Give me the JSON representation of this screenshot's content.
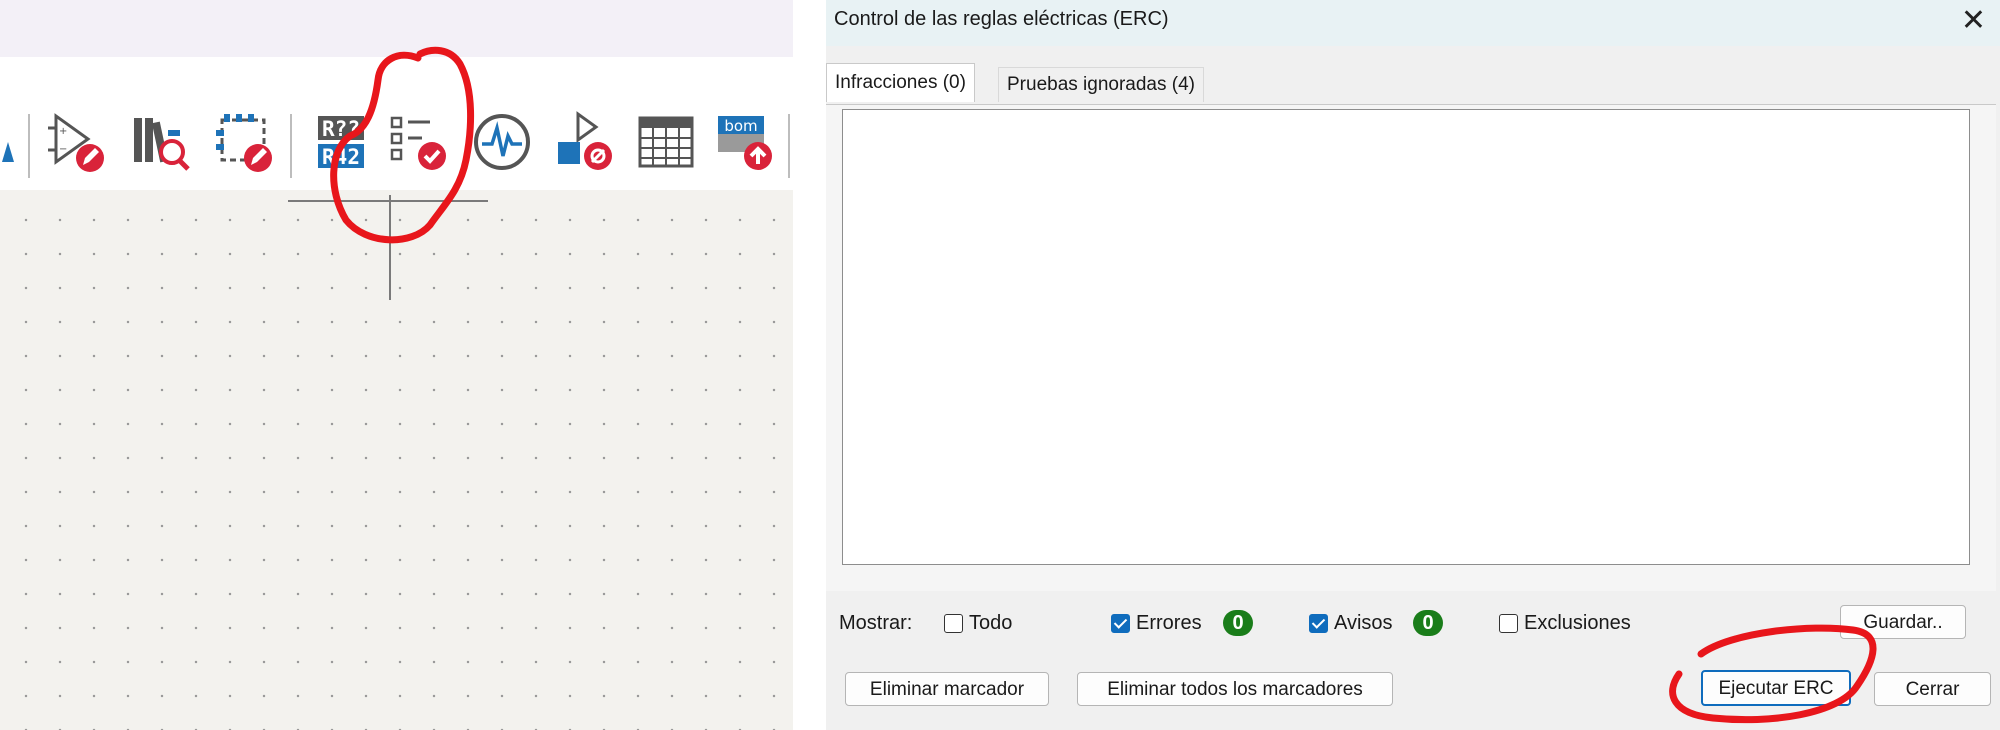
{
  "toolbar": {
    "icons": [
      "edit-symbol-icon",
      "library-browser-icon",
      "footprint-editor-icon",
      "annotate-icon",
      "erc-checklist-icon",
      "simulator-icon",
      "symbol-fields-icon",
      "field-table-icon",
      "bom-icon"
    ],
    "annotate_text_top": "R??",
    "annotate_text_bottom": "R42",
    "bom_text": "bom"
  },
  "dialog": {
    "title": "Control de las reglas eléctricas (ERC)",
    "close_glyph": "✕",
    "tabs": [
      {
        "label": "Infracciones (0)",
        "active": true
      },
      {
        "label": "Pruebas ignoradas (4)",
        "active": false
      }
    ],
    "filters": {
      "show_label": "Mostrar:",
      "all": {
        "label": "Todo",
        "checked": false
      },
      "errors": {
        "label": "Errores",
        "checked": true,
        "count": "0"
      },
      "warnings": {
        "label": "Avisos",
        "checked": true,
        "count": "0"
      },
      "exclusions": {
        "label": "Exclusiones",
        "checked": false
      }
    },
    "buttons": {
      "save": "Guardar..",
      "delete_marker": "Eliminar marcador",
      "delete_all_markers": "Eliminar todos los marcadores",
      "run_erc": "Ejecutar ERC",
      "close": "Cerrar"
    }
  },
  "colors": {
    "annotation_red": "#e8161b",
    "accent_blue": "#0f6cbd",
    "badge_green": "#1a7d1a"
  }
}
